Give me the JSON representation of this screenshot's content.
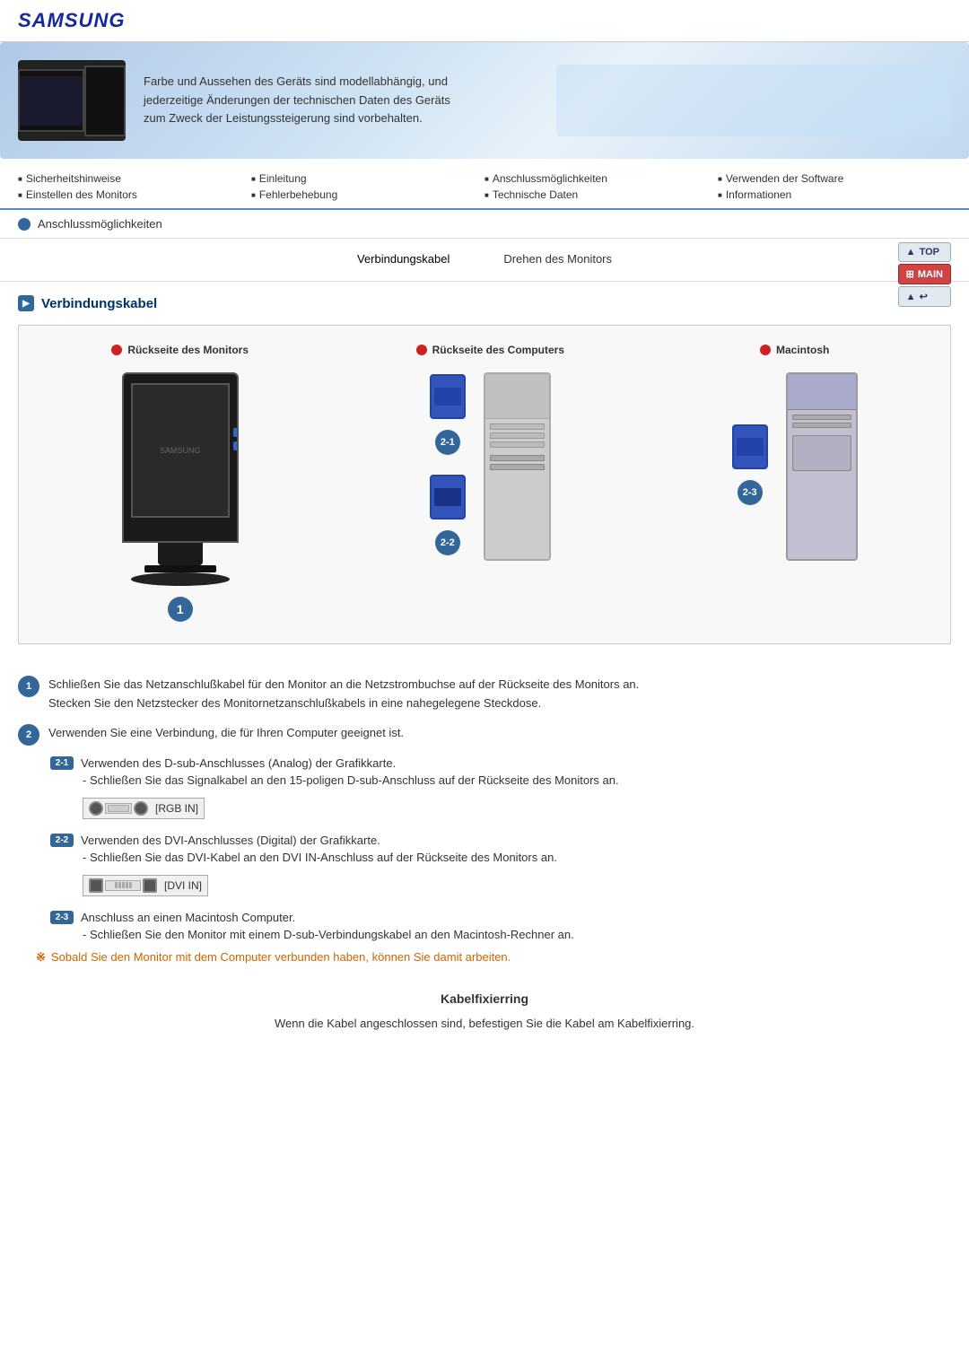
{
  "brand": {
    "name": "SAMSUNG"
  },
  "banner": {
    "text": "Farbe und Aussehen des Geräts sind modellabhängig, und jederzeitige Änderungen der technischen Daten des Geräts zum Zweck der Leistungssteigerung sind vorbehalten."
  },
  "nav": {
    "row1": [
      {
        "label": "Sicherheitshinweise"
      },
      {
        "label": "Einleitung"
      },
      {
        "label": "Anschlussmöglichkeiten"
      },
      {
        "label": "Verwenden der Software"
      }
    ],
    "row2": [
      {
        "label": "Einstellen des Monitors"
      },
      {
        "label": "Fehlerbehebung"
      },
      {
        "label": "Technische Daten"
      },
      {
        "label": "Informationen"
      }
    ]
  },
  "side_buttons": {
    "top": "TOP",
    "main": "MAIN",
    "back": "←"
  },
  "breadcrumb": {
    "label": "Anschlussmöglichkeiten"
  },
  "tabs": [
    {
      "label": "Verbindungskabel",
      "active": true
    },
    {
      "label": "Drehen des Monitors",
      "active": false
    }
  ],
  "section": {
    "title": "Verbindungskabel"
  },
  "diagram": {
    "sections": [
      {
        "title": "Rückseite des Monitors",
        "badge": "1"
      },
      {
        "title": "Rückseite des Computers",
        "badge": "2-1",
        "badge2": "2-2"
      },
      {
        "title": "Macintosh",
        "badge": "2-3"
      }
    ]
  },
  "instructions": [
    {
      "num": "1",
      "main": "Schließen Sie das Netzanschlußkabel für den Monitor an die Netzstrombuchse auf der Rückseite des Monitors an.",
      "sub": "Stecken Sie den Netzstecker des Monitornetzanschlußkabels in eine nahegelegene Steckdose."
    },
    {
      "num": "2",
      "main": "Verwenden Sie eine Verbindung, die für Ihren Computer geeignet ist.",
      "subs": [
        {
          "badge": "2-1",
          "text": "Verwenden des D-sub-Anschlusses (Analog) der Grafikkarte.",
          "detail": "- Schließen Sie das Signalkabel an den 15-poligen D-sub-Anschluss auf der Rückseite des Monitors an.",
          "connector_label": "[RGB IN]"
        },
        {
          "badge": "2-2",
          "text": "Verwenden des DVI-Anschlusses (Digital) der Grafikkarte.",
          "detail": "- Schließen Sie das DVI-Kabel an den DVI IN-Anschluss auf der Rückseite des Monitors an.",
          "connector_label": "[DVI IN]"
        },
        {
          "badge": "2-3",
          "text": "Anschluss an einen Macintosh Computer.",
          "detail": "- Schließen Sie den Monitor mit einem D-sub-Verbindungskabel an den Macintosh-Rechner an."
        }
      ]
    }
  ],
  "note": "Sobald Sie den Monitor mit dem Computer verbunden haben, können Sie damit arbeiten.",
  "kabel": {
    "title": "Kabelfixierring",
    "text": "Wenn die Kabel angeschlossen sind, befestigen Sie die Kabel am Kabelfixierring."
  }
}
